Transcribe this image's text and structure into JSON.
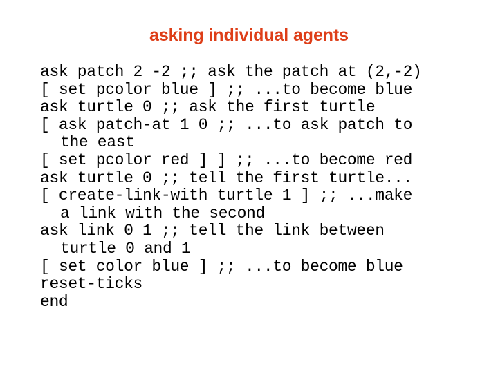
{
  "slide": {
    "title": "asking individual agents",
    "title_color": "#DE3E18",
    "background_color": "#FFFFFF",
    "text_color": "#000000"
  },
  "code": {
    "language": "NetLogo",
    "lines": [
      {
        "text": "ask patch 2 -2 ;; ask the patch at (2,-2)",
        "continuation": false
      },
      {
        "text": "[ set pcolor blue ] ;; ...to become blue",
        "continuation": false
      },
      {
        "text": "ask turtle 0 ;; ask the first turtle",
        "continuation": false
      },
      {
        "text": "[ ask patch-at 1 0 ;; ...to ask patch to",
        "continuation": false
      },
      {
        "text": "the east",
        "continuation": true
      },
      {
        "text": "[ set pcolor red ] ] ;; ...to become red",
        "continuation": false
      },
      {
        "text": "ask turtle 0 ;; tell the first turtle...",
        "continuation": false
      },
      {
        "text": "[ create-link-with turtle 1 ] ;; ...make",
        "continuation": false
      },
      {
        "text": "a link with the second",
        "continuation": true
      },
      {
        "text": "ask link 0 1 ;; tell the link between",
        "continuation": false
      },
      {
        "text": "turtle 0 and 1",
        "continuation": true
      },
      {
        "text": "[ set color blue ] ;; ...to become blue",
        "continuation": false
      },
      {
        "text": "reset-ticks",
        "continuation": false
      },
      {
        "text": "end",
        "continuation": false
      }
    ]
  }
}
